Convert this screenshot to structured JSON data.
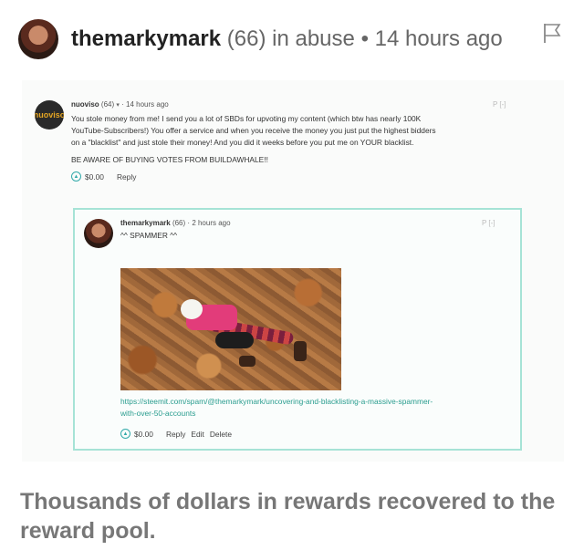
{
  "header": {
    "author": "themarkymark",
    "reputation": "(66)",
    "category_text": "in abuse",
    "separator": "•",
    "time": "14 hours ago"
  },
  "parent_comment": {
    "avatar_text": "nuoviso",
    "author": "nuoviso",
    "reputation": "(64)",
    "caret": "▾",
    "separator": "·",
    "time": "14 hours ago",
    "controls": "P [-]",
    "body_lines": [
      "You stole money from me! I send you a lot of SBDs for upvoting my content (which btw has nearly 100K",
      "YouTube-Subscribers!) You offer a service and when you receive the money you just put the highest bidders",
      "on a \"blacklist\" and just stole their money! And you did it weeks before you put me on YOUR blacklist."
    ],
    "warning": "BE AWARE OF BUYING VOTES FROM BUILDAWHALE!!",
    "payout": "$0.00",
    "reply_label": "Reply"
  },
  "reply_comment": {
    "author": "themarkymark",
    "reputation": "(66)",
    "separator": "·",
    "time": "2 hours ago",
    "controls": "P [-]",
    "body": "^^ SPAMMER ^^",
    "link_line1": "https://steemit.com/spam/@themarkymark/uncovering-and-blacklisting-a-massive-spammer-",
    "link_line2": "with-over-50-accounts",
    "payout": "$0.00",
    "reply_label": "Reply",
    "edit_label": "Edit",
    "delete_label": "Delete"
  },
  "footer": {
    "headline": "Thousands of dollars in rewards recovered to the reward pool."
  },
  "icons": {
    "flag": "flag-icon",
    "upvote": "upvote-icon"
  },
  "colors": {
    "reply_border": "#a6e3d6",
    "link": "#2a9d8f",
    "headline": "#777777"
  }
}
